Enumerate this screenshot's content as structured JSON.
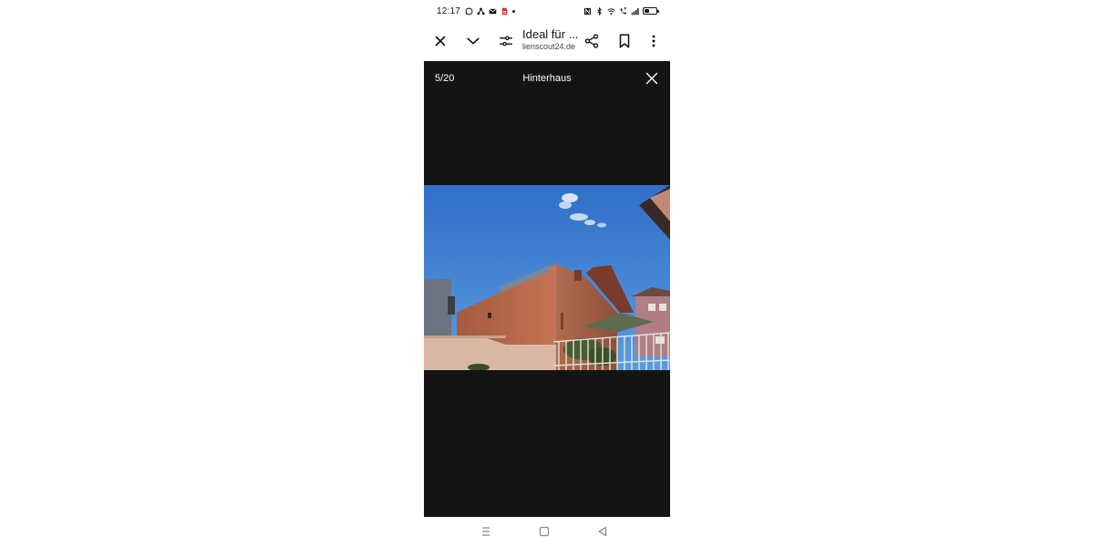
{
  "status_bar": {
    "time": "12:17",
    "battery_level": 0.4,
    "left_icons": [
      "whatsapp-icon",
      "network-share-icon",
      "mail-icon",
      "pdf-icon",
      "more-notifications-dot"
    ],
    "right_icons": [
      "nfc-icon",
      "bluetooth-icon",
      "wifi-icon",
      "volte-call-icon",
      "cellular-signal-icon",
      "battery-icon"
    ]
  },
  "toolbar": {
    "title": "Ideal für ...",
    "url": "lienscout24.de",
    "buttons": [
      "close-icon",
      "chevron-down-icon",
      "page-settings-icon",
      "share-icon",
      "bookmark-icon",
      "more-vert-icon"
    ]
  },
  "viewer": {
    "counter": "5/20",
    "caption": "Hinterhaus",
    "background": "#141414"
  },
  "navbar": {
    "buttons": [
      "recent-apps-icon",
      "home-icon",
      "back-icon"
    ]
  }
}
